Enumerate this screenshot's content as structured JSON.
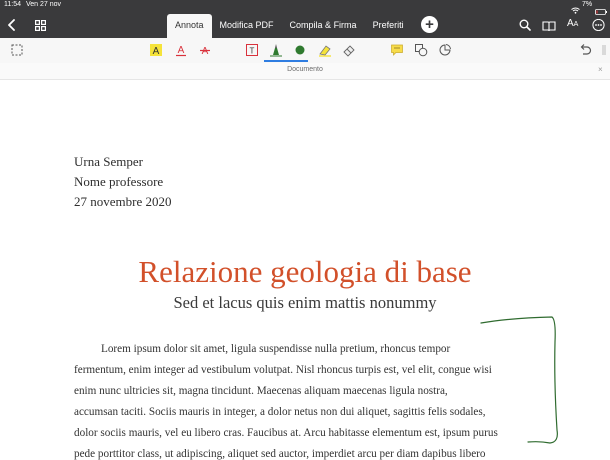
{
  "status": {
    "time": "11:54",
    "date": "Ven 27 nov",
    "battery": "7%"
  },
  "tabs": [
    "Annota",
    "Modifica PDF",
    "Compila & Firma",
    "Preferiti"
  ],
  "aa": {
    "big": "A",
    "small": "A"
  },
  "document_bar": {
    "title": "Documento",
    "close": "×"
  },
  "document": {
    "author": "Urna Semper",
    "professor": "Nome professore",
    "date": "27 novembre 2020",
    "title": "Relazione geologia di base",
    "subtitle": "Sed et lacus quis enim mattis nonummy",
    "paragraph_lines": [
      "Lorem ipsum dolor sit amet, ligula suspendisse nulla pretium, rhoncus tempor",
      "fermentum, enim integer ad vestibulum volutpat. Nisl rhoncus turpis est, vel elit, congue wisi",
      "enim nunc ultricies sit, magna tincidunt. Maecenas aliquam maecenas ligula nostra,",
      "accumsan taciti. Sociis mauris in integer, a dolor netus non dui aliquet, sagittis felis sodales,",
      "dolor sociis mauris, vel eu libero cras. Faucibus at. Arcu habitasse elementum est, ipsum purus",
      "pede porttitor class, ut adipiscing, aliquet sed auctor, imperdiet arcu per diam dapibus libero"
    ]
  },
  "colors": {
    "topbar": "#3a3a3c",
    "title": "#d2502a",
    "highlight_yellow": "#f5e33a",
    "text_red": "#d9323c",
    "pen_green": "#2f7a2f",
    "selection_blue": "#2f7de1",
    "ink_annotation": "#2f6b2f"
  },
  "icons": {
    "back": "chevron-left-icon",
    "grid": "grid-icon",
    "search": "search-icon",
    "book": "book-icon",
    "more": "more-icon"
  }
}
